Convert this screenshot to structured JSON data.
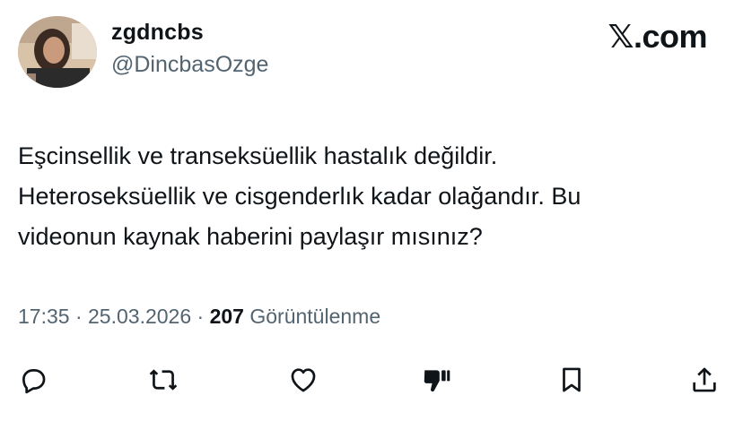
{
  "user": {
    "display_name": "zgdncbs",
    "handle": "@DincbasOzge"
  },
  "brand": {
    "label": "𝕏.com"
  },
  "tweet": {
    "line1": "Eşcinsellik ve transeksüellik hastalık değildir.",
    "line2": "Heteroseksüellik ve cisgenderlık kadar olağandır. Bu",
    "line3": "videonun kaynak haberini paylaşır mısınız?"
  },
  "meta": {
    "time": "17:35",
    "separator": "·",
    "date": "25.03.2026",
    "views_count": "207",
    "views_label": "Görüntülenme"
  },
  "actions": {
    "icons": [
      "reply-icon",
      "retweet-icon",
      "like-icon",
      "dislike-icon",
      "bookmark-icon",
      "share-icon"
    ]
  }
}
